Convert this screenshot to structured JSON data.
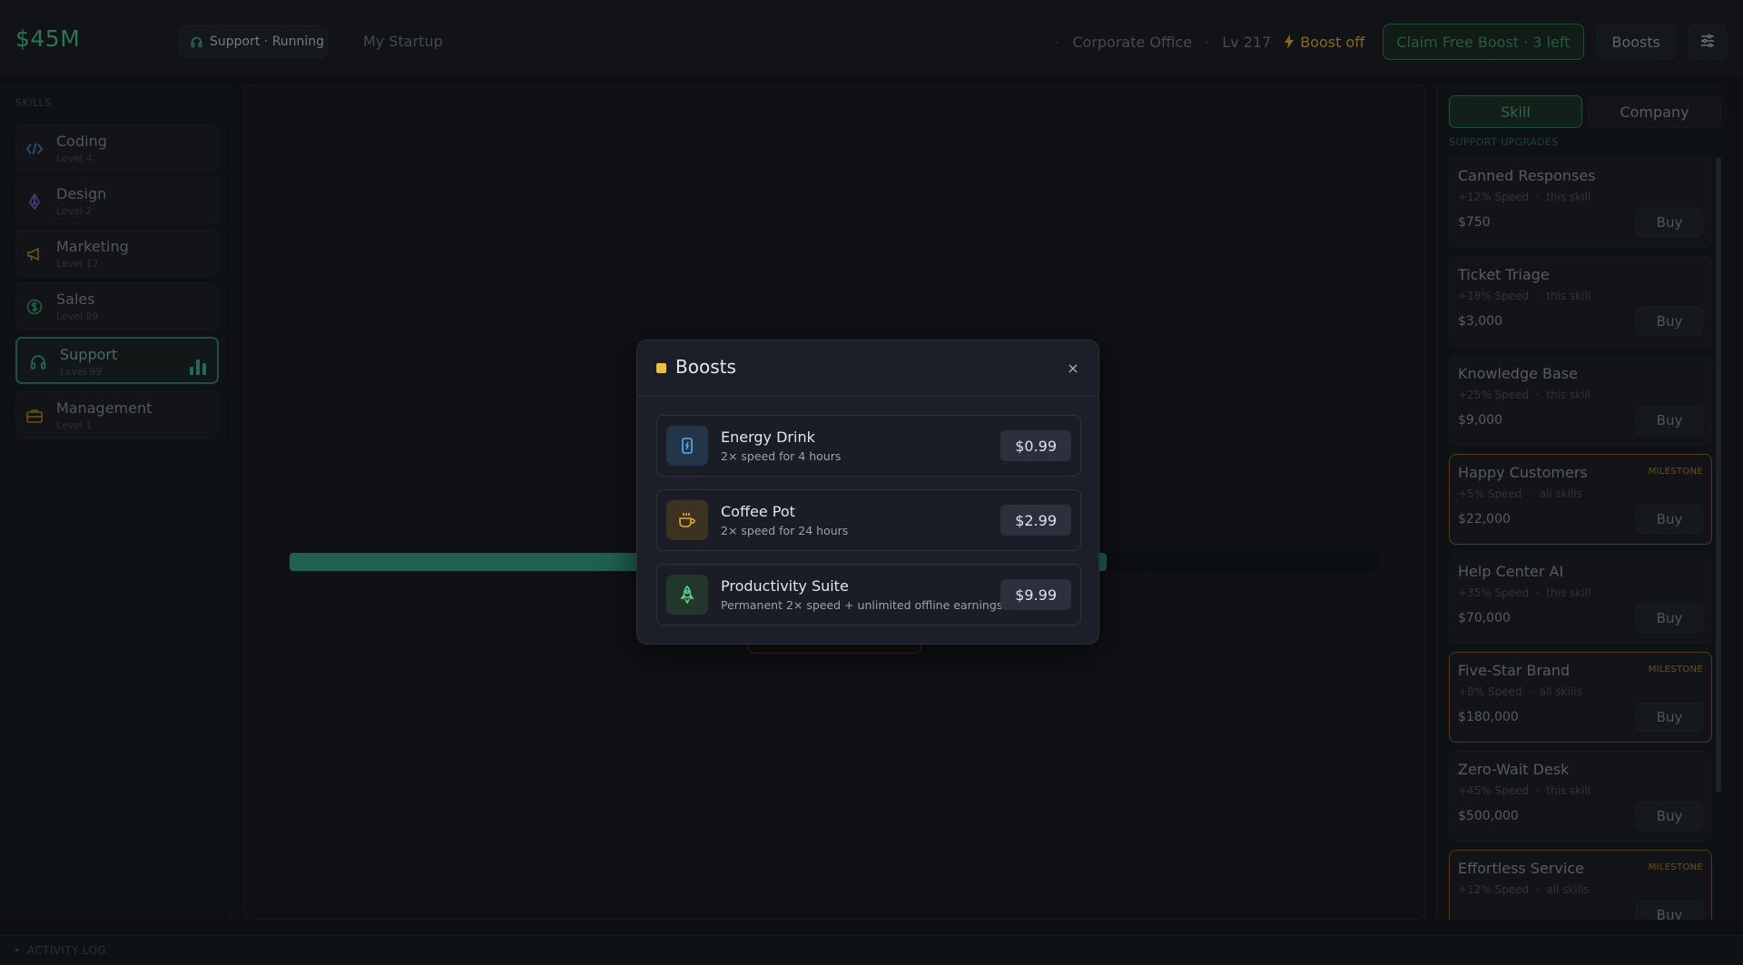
{
  "topbar": {
    "money": "$45M",
    "status": "Support · Running",
    "company": "My Startup",
    "office": "Corporate Office",
    "level": "Lv 217",
    "boost_status": "Boost off",
    "claim_label": "Claim Free Boost · 3 left",
    "boosts_label": "Boosts"
  },
  "sidebar": {
    "heading": "SKILLS",
    "items": [
      {
        "name": "Coding",
        "level": "Level 4",
        "icon": "code-icon"
      },
      {
        "name": "Design",
        "level": "Level 2",
        "icon": "pen-icon"
      },
      {
        "name": "Marketing",
        "level": "Level 17",
        "icon": "megaphone-icon"
      },
      {
        "name": "Sales",
        "level": "Level 99",
        "icon": "dollar-icon"
      },
      {
        "name": "Support",
        "level": "Level 99",
        "icon": "headset-icon"
      },
      {
        "name": "Management",
        "level": "Level 1",
        "icon": "briefcase-icon"
      }
    ]
  },
  "main": {
    "progress": 0.75
  },
  "rpanel": {
    "tabs": [
      "Skill",
      "Company"
    ],
    "heading": "SUPPORT UPGRADES",
    "upgrades": [
      {
        "name": "Canned Responses",
        "effect": "+12% Speed",
        "scope": "this skill",
        "price": "$750",
        "milestone": false
      },
      {
        "name": "Ticket Triage",
        "effect": "+18% Speed",
        "scope": "this skill",
        "price": "$3,000",
        "milestone": false
      },
      {
        "name": "Knowledge Base",
        "effect": "+25% Speed",
        "scope": "this skill",
        "price": "$9,000",
        "milestone": false
      },
      {
        "name": "Happy Customers",
        "effect": "+5% Speed",
        "scope": "all skills",
        "price": "$22,000",
        "milestone": true
      },
      {
        "name": "Help Center AI",
        "effect": "+35% Speed",
        "scope": "this skill",
        "price": "$70,000",
        "milestone": false
      },
      {
        "name": "Five-Star Brand",
        "effect": "+8% Speed",
        "scope": "all skills",
        "price": "$180,000",
        "milestone": true
      },
      {
        "name": "Zero-Wait Desk",
        "effect": "+45% Speed",
        "scope": "this skill",
        "price": "$500,000",
        "milestone": false
      },
      {
        "name": "Effortless Service",
        "effect": "+12% Speed",
        "scope": "all skills",
        "price": "",
        "milestone": true
      }
    ],
    "buy_label": "Buy",
    "milestone_label": "MILESTONE"
  },
  "activity_log": {
    "label": "ACTIVITY LOG"
  },
  "modal": {
    "title": "Boosts",
    "close": "×",
    "items": [
      {
        "name": "Energy Drink",
        "desc": "2× speed for 4 hours",
        "price": "$0.99",
        "icon": "can-icon"
      },
      {
        "name": "Coffee Pot",
        "desc": "2× speed for 24 hours",
        "price": "$2.99",
        "icon": "coffee-icon"
      },
      {
        "name": "Productivity Suite",
        "desc": "Permanent 2× speed + unlimited offline earnings",
        "price": "$9.99",
        "icon": "rocket-icon"
      }
    ]
  },
  "colors": {
    "accent_green": "#3f9a6d",
    "teal": "#2d7f6e",
    "gold": "#f2c038",
    "milestone": "#8d6a22"
  }
}
